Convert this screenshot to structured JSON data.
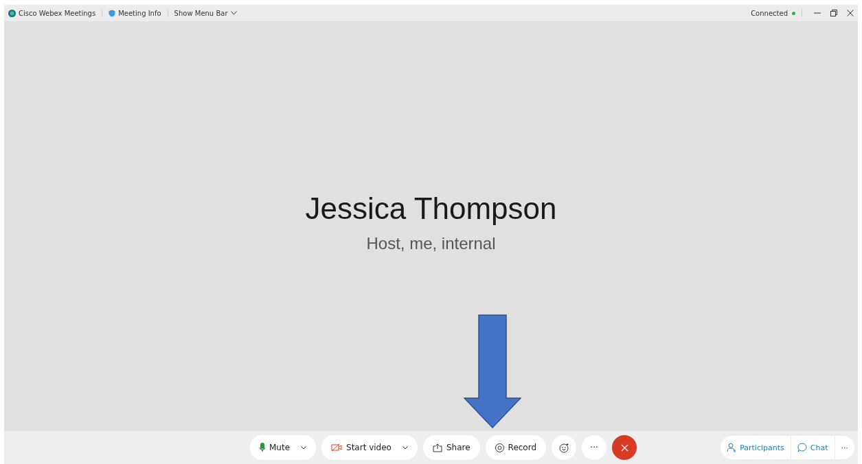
{
  "title_bar": {
    "app_name": "Cisco Webex Meetings",
    "meeting_info": "Meeting Info",
    "menu_toggle": "Show Menu Bar",
    "status": "Connected",
    "connected": true
  },
  "stage": {
    "name": "Jessica Thompson",
    "subtitle": "Host, me, internal",
    "annotation": {
      "kind": "arrow"
    }
  },
  "controls": [
    {
      "kind": "mute",
      "label": "Mute",
      "dropdown": true
    },
    {
      "kind": "video",
      "label": "Start video",
      "dropdown": true
    },
    {
      "kind": "share",
      "label": "Share",
      "dropdown": false
    },
    {
      "kind": "record",
      "label": "Record",
      "dropdown": false
    },
    {
      "kind": "reactions"
    },
    {
      "kind": "more",
      "label": "···"
    },
    {
      "kind": "end"
    }
  ],
  "side_controls": [
    {
      "kind": "participants",
      "label": "Participants"
    },
    {
      "kind": "chat",
      "label": "Chat"
    },
    {
      "kind": "more",
      "label": "···"
    }
  ]
}
